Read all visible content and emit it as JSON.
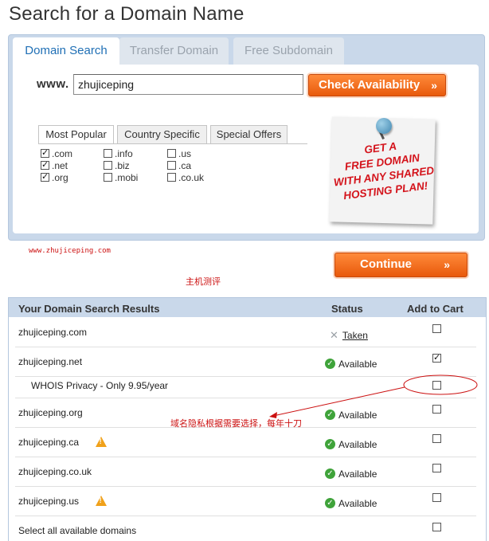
{
  "page": {
    "title": "Search for a Domain Name"
  },
  "tabs": {
    "domain_search": "Domain Search",
    "transfer_domain": "Transfer Domain",
    "free_subdomain": "Free Subdomain"
  },
  "search": {
    "prefix": "www.",
    "value": "zhujiceping",
    "button_label": "Check Availability",
    "button_chevron": "»"
  },
  "subtabs": {
    "most_popular": "Most Popular",
    "country_specific": "Country Specific",
    "special_offers": "Special Offers"
  },
  "tlds": [
    {
      "label": ".com",
      "checked": true
    },
    {
      "label": ".net",
      "checked": true
    },
    {
      "label": ".org",
      "checked": true
    },
    {
      "label": ".info",
      "checked": false
    },
    {
      "label": ".biz",
      "checked": false
    },
    {
      "label": ".mobi",
      "checked": false
    },
    {
      "label": ".us",
      "checked": false
    },
    {
      "label": ".ca",
      "checked": false
    },
    {
      "label": ".co.uk",
      "checked": false
    }
  ],
  "promo": {
    "lines": [
      "GET A",
      "FREE DOMAIN",
      "WITH ANY SHARED",
      "HOSTING PLAN!"
    ]
  },
  "watermark": {
    "url": "www.zhujiceping.com",
    "cn": "主机测评"
  },
  "continue": {
    "label": "Continue",
    "chevron": "»"
  },
  "results": {
    "headers": {
      "domain": "Your Domain Search Results",
      "status": "Status",
      "cart": "Add to Cart"
    },
    "rows": [
      {
        "domain": "zhujiceping.com",
        "status": "Taken",
        "status_icon": "x-icon",
        "warning": false,
        "checked": false
      },
      {
        "domain": "zhujiceping.net",
        "status": "Available",
        "status_icon": "check-circle-icon",
        "warning": false,
        "checked": true
      },
      {
        "domain": "WHOIS Privacy - Only 9.95/year",
        "status": "",
        "status_icon": "",
        "warning": false,
        "checked": false
      },
      {
        "domain": "zhujiceping.org",
        "status": "Available",
        "status_icon": "check-circle-icon",
        "warning": false,
        "checked": false
      },
      {
        "domain": "zhujiceping.ca",
        "status": "Available",
        "status_icon": "check-circle-icon",
        "warning": true,
        "checked": false
      },
      {
        "domain": "zhujiceping.co.uk",
        "status": "Available",
        "status_icon": "check-circle-icon",
        "warning": false,
        "checked": false
      },
      {
        "domain": "zhujiceping.us",
        "status": "Available",
        "status_icon": "check-circle-icon",
        "warning": true,
        "checked": false
      },
      {
        "domain": "Select all available domains",
        "status": "",
        "status_icon": "",
        "warning": false,
        "checked": false
      }
    ]
  },
  "annotation": {
    "text": "域名隐私根据需要选择，每年十刀"
  },
  "colors": {
    "accent_orange": "#e85a0c",
    "panel_blue": "#c9d8ea",
    "annotation_red": "#cc1111",
    "available_green": "#3fa33a"
  }
}
